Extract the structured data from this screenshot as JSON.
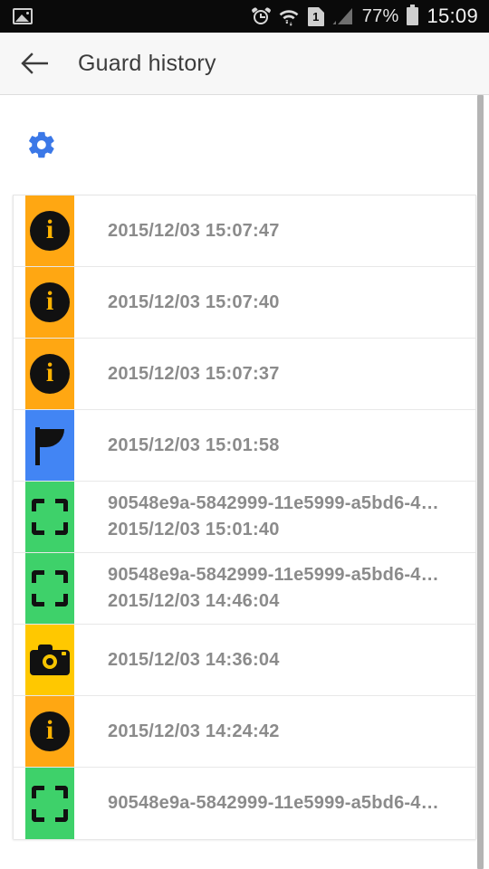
{
  "status_bar": {
    "left_icons": [
      "gallery-icon"
    ],
    "alarm_icon": "alarm-clock-icon",
    "wifi_icon": "wifi-icon",
    "sim_label": "1",
    "signal_icon": "cellular-signal-icon",
    "battery_percent": "77%",
    "battery_icon": "battery-icon",
    "clock": "15:09"
  },
  "appbar": {
    "back_icon": "back-arrow-icon",
    "title": "Guard history"
  },
  "toolbar": {
    "settings_icon": "gear-icon",
    "settings_color": "#3b78e7"
  },
  "colors": {
    "info_tile": "#FFA712",
    "flag_tile": "#4285F4",
    "scan_tile": "#3ED16A",
    "camera_tile": "#FFC800",
    "text_gray": "#8b8b8b",
    "appbar_bg": "#f7f7f7",
    "statusbar_bg": "#0a0a0a"
  },
  "history": {
    "rows": [
      {
        "icon": "info-icon",
        "tile": "#FFA712",
        "title": "",
        "timestamp": "2015/12/03 15:07:47"
      },
      {
        "icon": "info-icon",
        "tile": "#FFA712",
        "title": "",
        "timestamp": "2015/12/03 15:07:40"
      },
      {
        "icon": "info-icon",
        "tile": "#FFA712",
        "title": "",
        "timestamp": "2015/12/03 15:07:37"
      },
      {
        "icon": "flag-icon",
        "tile": "#4285F4",
        "title": "",
        "timestamp": "2015/12/03 15:01:58"
      },
      {
        "icon": "scan-icon",
        "tile": "#3ED16A",
        "title": "90548e9a-5842999-11e5999-a5bd6-4…",
        "timestamp": "2015/12/03 15:01:40"
      },
      {
        "icon": "scan-icon",
        "tile": "#3ED16A",
        "title": "90548e9a-5842999-11e5999-a5bd6-4…",
        "timestamp": "2015/12/03 14:46:04"
      },
      {
        "icon": "camera-icon",
        "tile": "#FFC800",
        "title": "",
        "timestamp": "2015/12/03 14:36:04"
      },
      {
        "icon": "info-icon",
        "tile": "#FFA712",
        "title": "",
        "timestamp": "2015/12/03 14:24:42"
      },
      {
        "icon": "scan-icon",
        "tile": "#3ED16A",
        "title": "90548e9a-5842999-11e5999-a5bd6-4…",
        "timestamp": ""
      }
    ]
  }
}
